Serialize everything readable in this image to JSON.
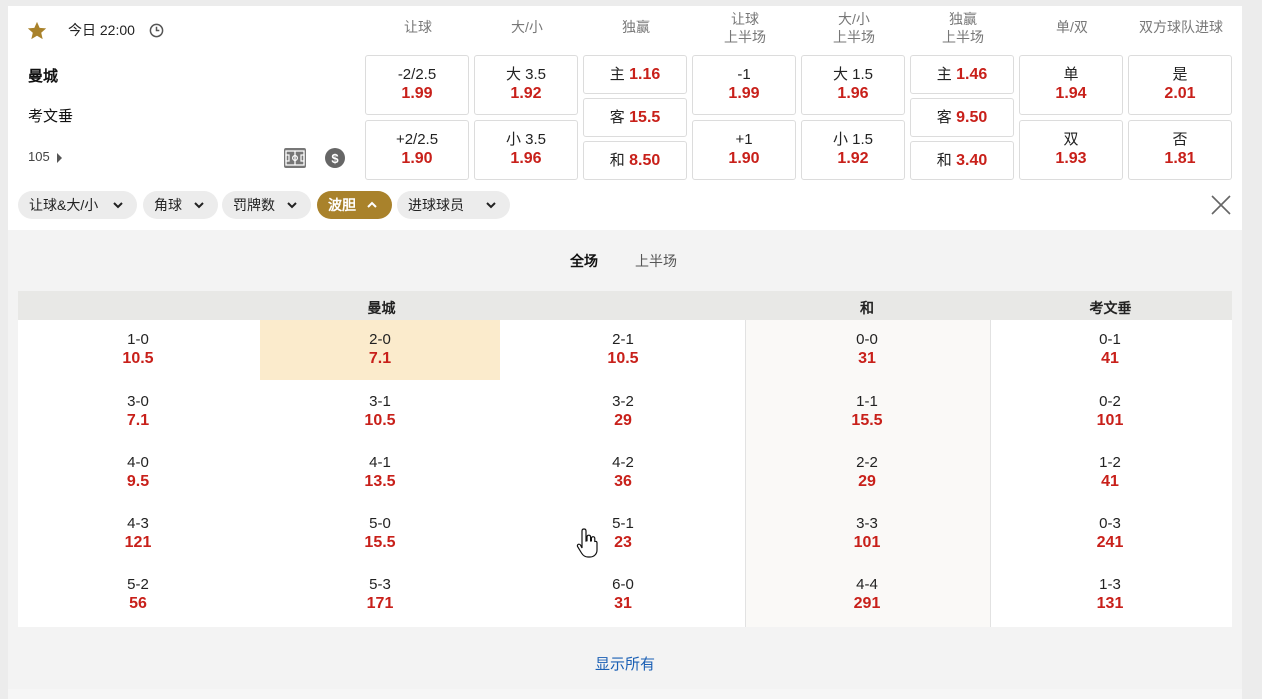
{
  "match": {
    "time": "今日 22:00",
    "home": "曼城",
    "away": "考文垂",
    "more_count": "105"
  },
  "columns": [
    {
      "l1": "让球",
      "l2": ""
    },
    {
      "l1": "大/小",
      "l2": ""
    },
    {
      "l1": "独赢",
      "l2": ""
    },
    {
      "l1": "让球",
      "l2": "上半场"
    },
    {
      "l1": "大/小",
      "l2": "上半场"
    },
    {
      "l1": "独赢",
      "l2": "上半场"
    },
    {
      "l1": "单/双",
      "l2": ""
    },
    {
      "l1": "双方球队进球",
      "l2": ""
    }
  ],
  "odds": {
    "hdp": [
      {
        "lbl": "-2/2.5",
        "val": "1.99"
      },
      {
        "lbl": "+2/2.5",
        "val": "1.90"
      }
    ],
    "ou": [
      {
        "lbl": "大 3.5",
        "val": "1.92"
      },
      {
        "lbl": "小 3.5",
        "val": "1.96"
      }
    ],
    "x12": [
      {
        "lbl": "主",
        "val": "1.16"
      },
      {
        "lbl": "客",
        "val": "15.5"
      },
      {
        "lbl": "和",
        "val": "8.50"
      }
    ],
    "hdp_1h": [
      {
        "lbl": "-1",
        "val": "1.99"
      },
      {
        "lbl": "+1",
        "val": "1.90"
      }
    ],
    "ou_1h": [
      {
        "lbl": "大 1.5",
        "val": "1.96"
      },
      {
        "lbl": "小 1.5",
        "val": "1.92"
      }
    ],
    "x12_1h": [
      {
        "lbl": "主",
        "val": "1.46"
      },
      {
        "lbl": "客",
        "val": "9.50"
      },
      {
        "lbl": "和",
        "val": "3.40"
      }
    ],
    "oe": [
      {
        "lbl": "单",
        "val": "1.94"
      },
      {
        "lbl": "双",
        "val": "1.93"
      }
    ],
    "btts": [
      {
        "lbl": "是",
        "val": "2.01"
      },
      {
        "lbl": "否",
        "val": "1.81"
      }
    ]
  },
  "chips": [
    {
      "label": "让球&大/小",
      "active": false
    },
    {
      "label": "角球",
      "active": false
    },
    {
      "label": "罚牌数",
      "active": false
    },
    {
      "label": "波胆",
      "active": true
    },
    {
      "label": "进球球员",
      "active": false
    }
  ],
  "tabs": {
    "full": "全场",
    "half": "上半场"
  },
  "cs_headers": {
    "home": "曼城",
    "draw": "和",
    "away": "考文垂"
  },
  "correct_score": {
    "home": [
      [
        {
          "s": "1-0",
          "o": "10.5"
        },
        {
          "s": "2-0",
          "o": "7.1"
        },
        {
          "s": "2-1",
          "o": "10.5"
        }
      ],
      [
        {
          "s": "3-0",
          "o": "7.1"
        },
        {
          "s": "3-1",
          "o": "10.5"
        },
        {
          "s": "3-2",
          "o": "29"
        }
      ],
      [
        {
          "s": "4-0",
          "o": "9.5"
        },
        {
          "s": "4-1",
          "o": "13.5"
        },
        {
          "s": "4-2",
          "o": "36"
        }
      ],
      [
        {
          "s": "4-3",
          "o": "121"
        },
        {
          "s": "5-0",
          "o": "15.5"
        },
        {
          "s": "5-1",
          "o": "23"
        }
      ],
      [
        {
          "s": "5-2",
          "o": "56"
        },
        {
          "s": "5-3",
          "o": "171"
        },
        {
          "s": "6-0",
          "o": "31"
        }
      ]
    ],
    "draw": [
      {
        "s": "0-0",
        "o": "31"
      },
      {
        "s": "1-1",
        "o": "15.5"
      },
      {
        "s": "2-2",
        "o": "29"
      },
      {
        "s": "3-3",
        "o": "101"
      },
      {
        "s": "4-4",
        "o": "291"
      }
    ],
    "away": [
      {
        "s": "0-1",
        "o": "41"
      },
      {
        "s": "0-2",
        "o": "101"
      },
      {
        "s": "1-2",
        "o": "41"
      },
      {
        "s": "0-3",
        "o": "241"
      },
      {
        "s": "1-3",
        "o": "131"
      }
    ]
  },
  "show_all": "显示所有",
  "colors": {
    "accent": "#a9822b",
    "odds": "#c8201a",
    "highlight": "#fbebcc",
    "link": "#1a5fb4"
  }
}
